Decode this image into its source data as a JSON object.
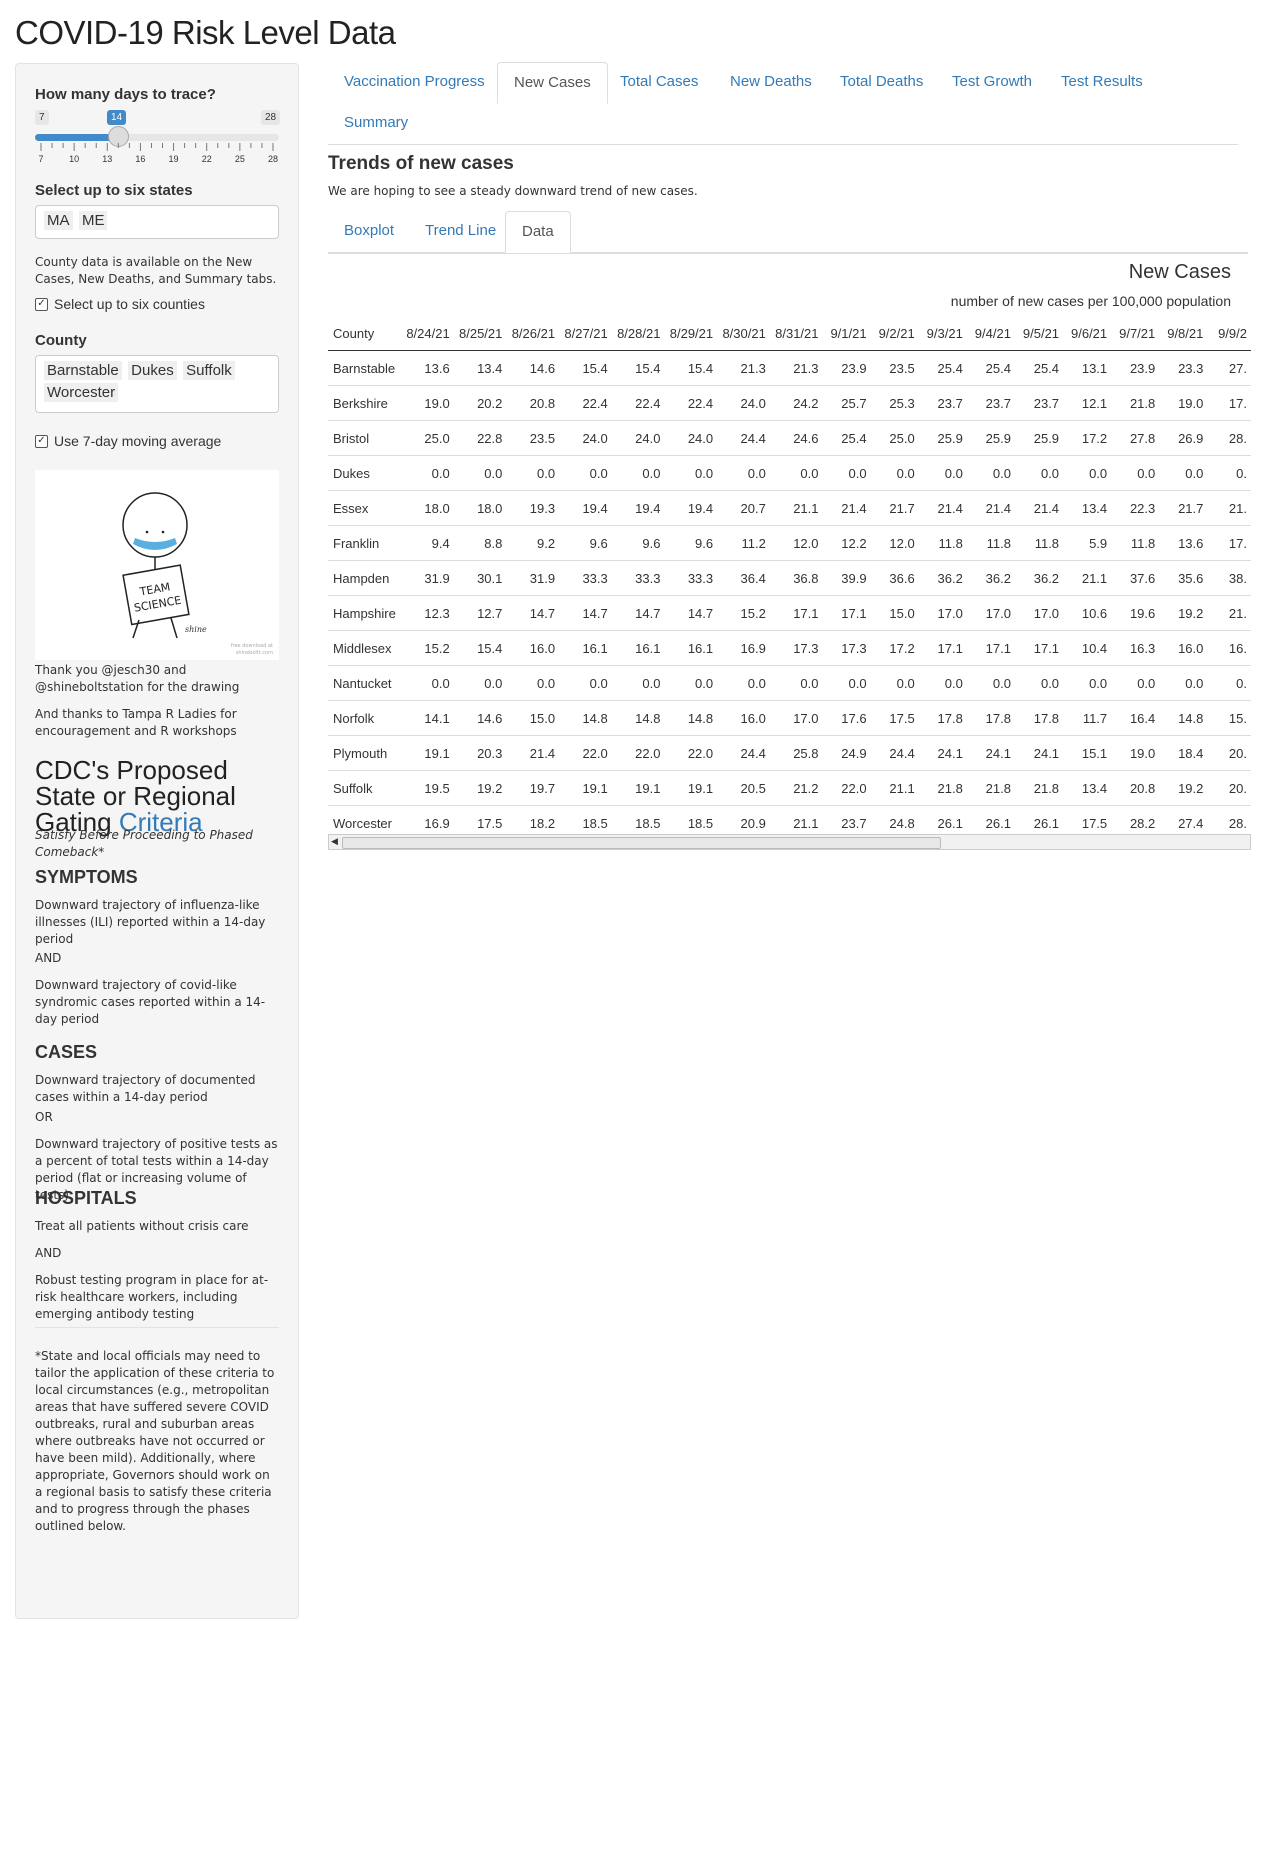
{
  "app": {
    "title": "COVID-19 Risk Level Data"
  },
  "sidebar": {
    "days_label": "How many days to trace?",
    "slider": {
      "min": "7",
      "max": "28",
      "value": "14",
      "ticks": [
        "7",
        "10",
        "13",
        "16",
        "19",
        "22",
        "25",
        "28"
      ]
    },
    "states_label": "Select up to six states",
    "states": [
      "MA",
      "ME"
    ],
    "county_note": "County data is available on the New Cases, New Deaths, and Summary tabs.",
    "select_counties_label": "Select up to six counties",
    "county_label": "County",
    "counties": [
      "Barnstable",
      "Dukes",
      "Suffolk",
      "Worcester"
    ],
    "moving_avg_label": "Use 7-day moving average",
    "drawing": {
      "sign_line1": "TEAM",
      "sign_line2": "SCIENCE",
      "signature": "shine",
      "credit_line1": "free download at",
      "credit_line2": "shineboltt.com"
    },
    "thanks1": "Thank you @jesch30 and @shineboltstation for the drawing",
    "thanks2": "And thanks to Tampa R Ladies for encouragement and R workshops",
    "cdc_title": "CDC's Proposed State or Regional Gating",
    "cdc_link": "Criteria",
    "cdc_sub": "Satisfy Before Proceeding to Phased Comeback*",
    "symptoms_head": "SYMPTOMS",
    "symptoms_1": "Downward trajectory of influenza-like illnesses (ILI) reported within a 14-day period",
    "and1": "AND",
    "symptoms_2": "Downward trajectory of covid-like syndromic cases reported within a 14-day period",
    "cases_head": "CASES",
    "cases_1": "Downward trajectory of documented cases within a 14-day period",
    "or1": "OR",
    "cases_2": "Downward trajectory of positive tests as a percent of total tests within a 14-day period (flat or increasing volume of tests)",
    "hospitals_head": "HOSPITALS",
    "hospitals_1": "Treat all patients without crisis care",
    "and2": "AND",
    "hospitals_2": "Robust testing program in place for at-risk healthcare workers, including emerging antibody testing",
    "footnote": "*State and local officials may need to tailor the application of these criteria to local circumstances (e.g., metropolitan areas that have suffered severe COVID outbreaks, rural and suburban areas where outbreaks have not occurred or have been mild). Additionally, where appropriate, Governors should work on a regional basis to satisfy these criteria and to progress through the phases outlined below."
  },
  "tabs": [
    "Vaccination Progress",
    "New Cases",
    "Total Cases",
    "New Deaths",
    "Total Deaths",
    "Test Growth",
    "Test Results",
    "Summary"
  ],
  "main": {
    "title": "Trends of new cases",
    "desc": "We are hoping to see a steady downward trend of new cases.",
    "subtabs": [
      "Boxplot",
      "Trend Line",
      "Data"
    ]
  },
  "table": {
    "title": "New Cases",
    "subtitle": "number of new cases per 100,000 population",
    "county_header": "County",
    "dates": [
      "8/24/21",
      "8/25/21",
      "8/26/21",
      "8/27/21",
      "8/28/21",
      "8/29/21",
      "8/30/21",
      "8/31/21",
      "9/1/21",
      "9/2/21",
      "9/3/21",
      "9/4/21",
      "9/5/21",
      "9/6/21",
      "9/7/21",
      "9/8/21",
      "9/9/2"
    ],
    "rows": [
      {
        "county": "Barnstable",
        "values": [
          "13.6",
          "13.4",
          "14.6",
          "15.4",
          "15.4",
          "15.4",
          "21.3",
          "21.3",
          "23.9",
          "23.5",
          "25.4",
          "25.4",
          "25.4",
          "13.1",
          "23.9",
          "23.3",
          "27."
        ]
      },
      {
        "county": "Berkshire",
        "values": [
          "19.0",
          "20.2",
          "20.8",
          "22.4",
          "22.4",
          "22.4",
          "24.0",
          "24.2",
          "25.7",
          "25.3",
          "23.7",
          "23.7",
          "23.7",
          "12.1",
          "21.8",
          "19.0",
          "17."
        ]
      },
      {
        "county": "Bristol",
        "values": [
          "25.0",
          "22.8",
          "23.5",
          "24.0",
          "24.0",
          "24.0",
          "24.4",
          "24.6",
          "25.4",
          "25.0",
          "25.9",
          "25.9",
          "25.9",
          "17.2",
          "27.8",
          "26.9",
          "28."
        ]
      },
      {
        "county": "Dukes",
        "values": [
          "0.0",
          "0.0",
          "0.0",
          "0.0",
          "0.0",
          "0.0",
          "0.0",
          "0.0",
          "0.0",
          "0.0",
          "0.0",
          "0.0",
          "0.0",
          "0.0",
          "0.0",
          "0.0",
          "0."
        ]
      },
      {
        "county": "Essex",
        "values": [
          "18.0",
          "18.0",
          "19.3",
          "19.4",
          "19.4",
          "19.4",
          "20.7",
          "21.1",
          "21.4",
          "21.7",
          "21.4",
          "21.4",
          "21.4",
          "13.4",
          "22.3",
          "21.7",
          "21."
        ]
      },
      {
        "county": "Franklin",
        "values": [
          "9.4",
          "8.8",
          "9.2",
          "9.6",
          "9.6",
          "9.6",
          "11.2",
          "12.0",
          "12.2",
          "12.0",
          "11.8",
          "11.8",
          "11.8",
          "5.9",
          "11.8",
          "13.6",
          "17."
        ]
      },
      {
        "county": "Hampden",
        "values": [
          "31.9",
          "30.1",
          "31.9",
          "33.3",
          "33.3",
          "33.3",
          "36.4",
          "36.8",
          "39.9",
          "36.6",
          "36.2",
          "36.2",
          "36.2",
          "21.1",
          "37.6",
          "35.6",
          "38."
        ]
      },
      {
        "county": "Hampshire",
        "values": [
          "12.3",
          "12.7",
          "14.7",
          "14.7",
          "14.7",
          "14.7",
          "15.2",
          "17.1",
          "17.1",
          "15.0",
          "17.0",
          "17.0",
          "17.0",
          "10.6",
          "19.6",
          "19.2",
          "21."
        ]
      },
      {
        "county": "Middlesex",
        "values": [
          "15.2",
          "15.4",
          "16.0",
          "16.1",
          "16.1",
          "16.1",
          "16.9",
          "17.3",
          "17.3",
          "17.2",
          "17.1",
          "17.1",
          "17.1",
          "10.4",
          "16.3",
          "16.0",
          "16."
        ]
      },
      {
        "county": "Nantucket",
        "values": [
          "0.0",
          "0.0",
          "0.0",
          "0.0",
          "0.0",
          "0.0",
          "0.0",
          "0.0",
          "0.0",
          "0.0",
          "0.0",
          "0.0",
          "0.0",
          "0.0",
          "0.0",
          "0.0",
          "0."
        ]
      },
      {
        "county": "Norfolk",
        "values": [
          "14.1",
          "14.6",
          "15.0",
          "14.8",
          "14.8",
          "14.8",
          "16.0",
          "17.0",
          "17.6",
          "17.5",
          "17.8",
          "17.8",
          "17.8",
          "11.7",
          "16.4",
          "14.8",
          "15."
        ]
      },
      {
        "county": "Plymouth",
        "values": [
          "19.1",
          "20.3",
          "21.4",
          "22.0",
          "22.0",
          "22.0",
          "24.4",
          "25.8",
          "24.9",
          "24.4",
          "24.1",
          "24.1",
          "24.1",
          "15.1",
          "19.0",
          "18.4",
          "20."
        ]
      },
      {
        "county": "Suffolk",
        "values": [
          "19.5",
          "19.2",
          "19.7",
          "19.1",
          "19.1",
          "19.1",
          "20.5",
          "21.2",
          "22.0",
          "21.1",
          "21.8",
          "21.8",
          "21.8",
          "13.4",
          "20.8",
          "19.2",
          "20."
        ]
      },
      {
        "county": "Worcester",
        "values": [
          "16.9",
          "17.5",
          "18.2",
          "18.5",
          "18.5",
          "18.5",
          "20.9",
          "21.1",
          "23.7",
          "24.8",
          "26.1",
          "26.1",
          "26.1",
          "17.5",
          "28.2",
          "27.4",
          "28."
        ]
      }
    ]
  }
}
